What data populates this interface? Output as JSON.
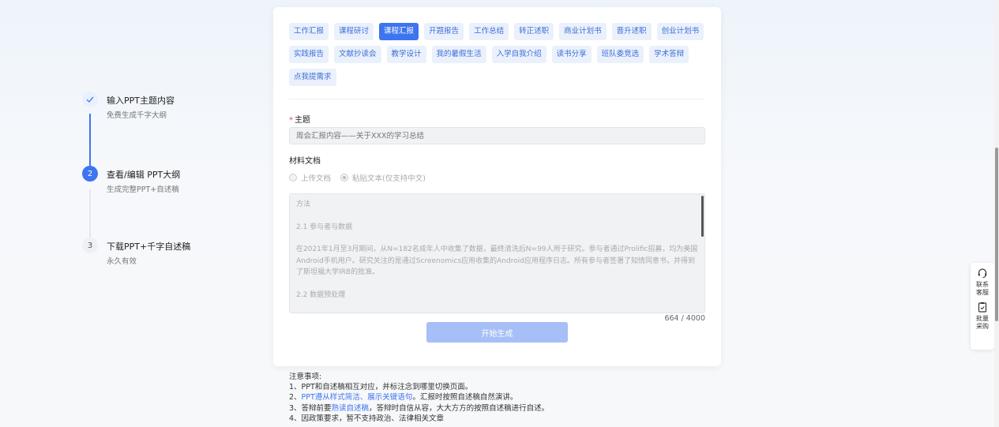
{
  "steps": [
    {
      "title": "输入PPT主题内容",
      "sub": "免费生成千字大纲",
      "state": "done"
    },
    {
      "number": "2",
      "title": "查看/编辑 PPT大纲",
      "sub": "生成完整PPT+自述稿",
      "state": "active"
    },
    {
      "number": "3",
      "title": "下载PPT+千字自述稿",
      "sub": "永久有效",
      "state": "todo"
    }
  ],
  "tags": [
    "工作汇报",
    "课程研讨",
    "课程汇报",
    "开题报告",
    "工作总结",
    "转正述职",
    "商业计划书",
    "晋升述职",
    "创业计划书",
    "实践报告",
    "文献抄读会",
    "教学设计",
    "我的暑假生活",
    "入学自我介绍",
    "读书分享",
    "班队委竞选",
    "学术答辩",
    "点我提需求"
  ],
  "active_tag": "课程汇报",
  "form": {
    "topic_required": "*",
    "topic_label": "主题",
    "topic_placeholder": "周会汇报内容——关于XXX的学习总结",
    "material_label": "材料文档",
    "radio_upload": "上传文档",
    "radio_paste": "粘贴文本(仅支持中文)",
    "text_p1": "方法",
    "text_p2": "2.1 参与者与数据",
    "text_p3": "在2021年1月至3月期间，从N=182名成年人中收集了数据，最终清洗后N=99人用于研究。参与者通过Prolific招募，均为美国Android手机用户。研究关注的是通过Screenomics应用收集的Android应用程序日志。所有参与者签署了知情同意书，并得到了斯坦福大学IRB的批准。",
    "text_p4": "2.2 数据预处理",
    "counter": "664 / 4000",
    "submit_label": "开始生成"
  },
  "notes": {
    "title": "注意事项:",
    "n1": "1、PPT和自述稿相互对应，并标注念到哪里切换页面。",
    "n2_a": "2、",
    "n2_hl": "PPT遵从样式简洁、展示关键语句",
    "n2_b": "。汇报时按照自述稿自然演讲。",
    "n3_a": "3、答辩前要",
    "n3_hl": "熟读自述稿",
    "n3_b": "，答辩时自信从容，大大方方的按照自述稿进行自述。",
    "n4": "4、因政策要求，暂不支持政治、法律相关文章"
  },
  "float": {
    "contact_l1": "联系",
    "contact_l2": "客服",
    "bulk_l1": "批量",
    "bulk_l2": "采购"
  },
  "colors": {
    "primary": "#3d74f0",
    "tag_bg": "#eaf1fc",
    "disabled_btn": "#a6bff6"
  }
}
